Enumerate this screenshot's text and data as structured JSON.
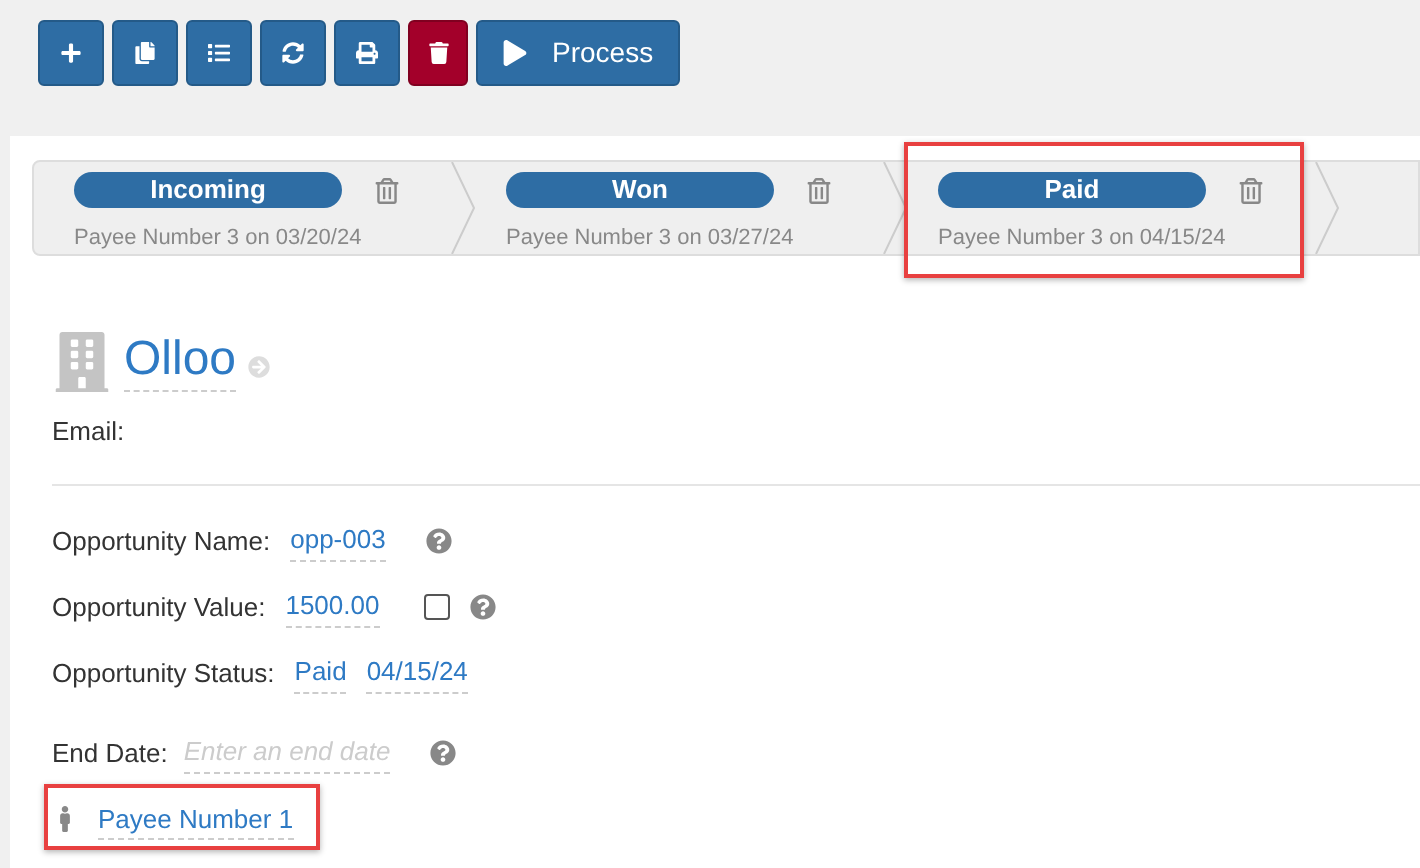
{
  "toolbar": {
    "buttons": [
      {
        "kind": "add"
      },
      {
        "kind": "copy"
      },
      {
        "kind": "list"
      },
      {
        "kind": "refresh"
      },
      {
        "kind": "print"
      },
      {
        "kind": "delete"
      },
      {
        "kind": "process",
        "label": "Process"
      }
    ]
  },
  "stages": [
    {
      "name": "Incoming",
      "caption": "Payee Number 3 on 03/20/24",
      "highlighted": false
    },
    {
      "name": "Won",
      "caption": "Payee Number 3 on 03/27/24",
      "highlighted": false
    },
    {
      "name": "Paid",
      "caption": "Payee Number 3 on 04/15/24",
      "highlighted": true
    }
  ],
  "company": {
    "name": "Olloo",
    "email_label": "Email:"
  },
  "fields": [
    {
      "kind": "text",
      "label": "Opportunity Name:",
      "value": "opp-003",
      "help": true
    },
    {
      "kind": "checkbox",
      "label": "Opportunity Value:",
      "value": "1500.00",
      "checked": false,
      "help": true
    },
    {
      "kind": "status",
      "label": "Opportunity Status:",
      "value": "Paid",
      "date": "04/15/24"
    },
    {
      "kind": "placeholder",
      "label": "End Date:",
      "placeholder": "Enter an end date",
      "help": true
    }
  ],
  "payee": {
    "name": "Payee Number 1",
    "highlighted": true
  }
}
